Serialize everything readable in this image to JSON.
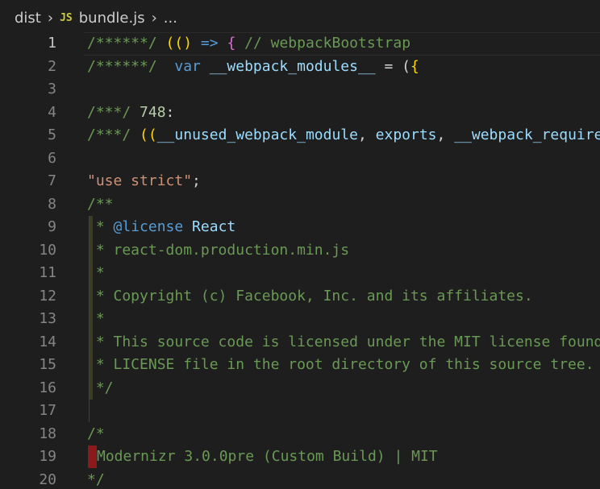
{
  "breadcrumb": {
    "folder": "dist",
    "file_icon": "JS",
    "file": "bundle.js",
    "tail": "..."
  },
  "editor": {
    "line_numbers": [
      "1",
      "2",
      "3",
      "4",
      "5",
      "6",
      "7",
      "8",
      "9",
      "10",
      "11",
      "12",
      "13",
      "14",
      "15",
      "16",
      "17",
      "18",
      "19",
      "20"
    ],
    "lines": {
      "l1": {
        "a": "/******/ ",
        "b": "((",
        "c": ") ",
        "d": "=>",
        "e": " { ",
        "f": "// webpackBootstrap"
      },
      "l2": {
        "a": "/******/  ",
        "b": "var",
        "c": " ",
        "d": "__webpack_modules__",
        "e": " = (",
        "f": "{"
      },
      "l4": {
        "a": "/***/ ",
        "b": "748",
        "c": ":"
      },
      "l5": {
        "a": "/***/ ",
        "b": "((",
        "c": "__unused_webpack_module",
        "d": ", ",
        "e": "exports",
        "f": ", ",
        "g": "__webpack_require__"
      },
      "l7": {
        "a": "\"use strict\"",
        "b": ";"
      },
      "l8": {
        "a": "/**"
      },
      "l9": {
        "a": " * ",
        "b": "@license",
        "c": " React"
      },
      "l10": {
        "a": " * react-dom.production.min.js"
      },
      "l11": {
        "a": " *"
      },
      "l12": {
        "a": " * Copyright (c) Facebook, Inc. and its affiliates."
      },
      "l13": {
        "a": " *"
      },
      "l14": {
        "a": " * This source code is licensed under the MIT license found in the"
      },
      "l15": {
        "a": " * LICENSE file in the root directory of this source tree."
      },
      "l16": {
        "a": " */"
      },
      "l18": {
        "a": "/*"
      },
      "l19": {
        "a": "Modernizr 3.0.0pre (Custom Build) | MIT"
      },
      "l20": {
        "a": "*/"
      }
    }
  },
  "colors": {
    "background": "#1e1e1e",
    "comment": "#6a9955",
    "keyword": "#569cd6",
    "string": "#ce9178",
    "number": "#b5cea8"
  }
}
